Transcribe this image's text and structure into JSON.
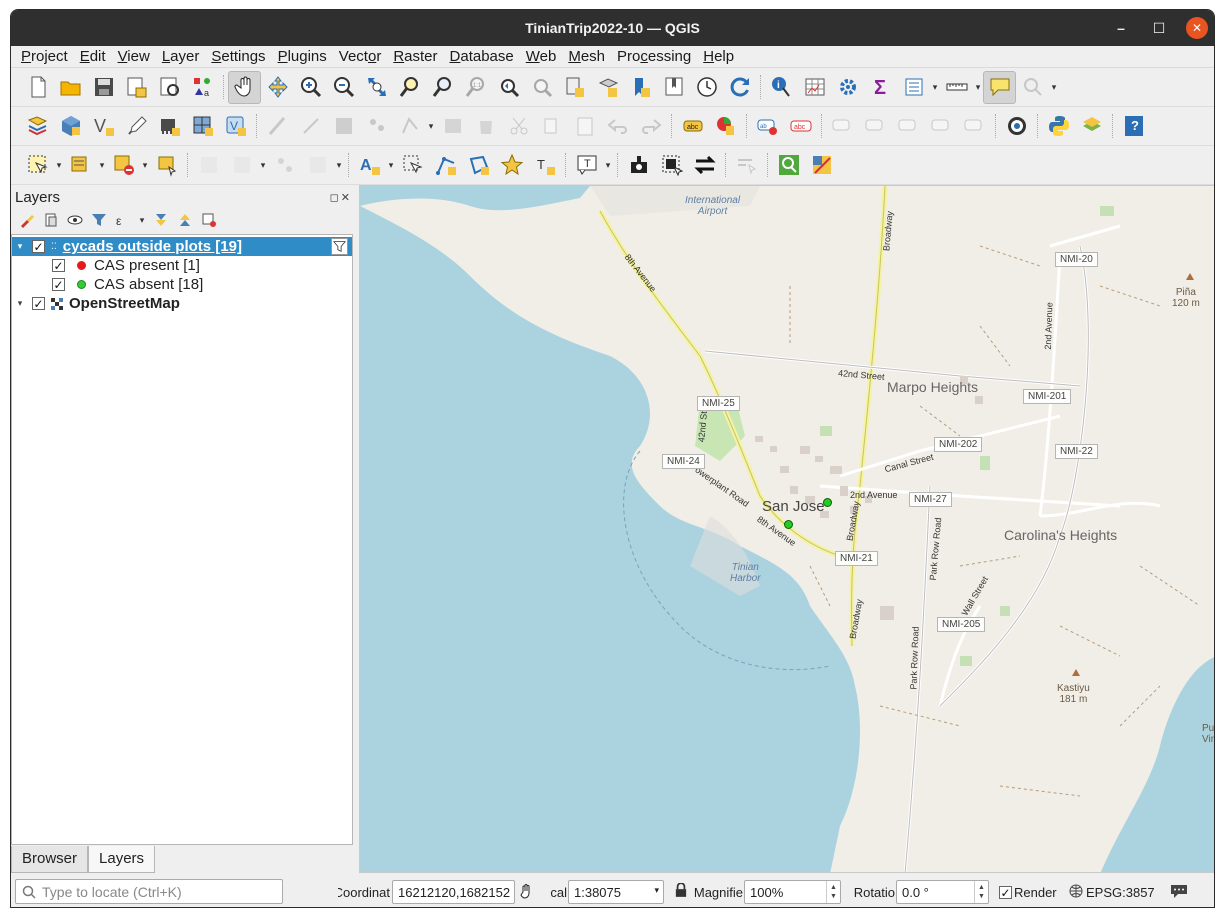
{
  "window": {
    "title": "TinianTrip2022-10 — QGIS",
    "minimize": "–",
    "maximize": "☐",
    "close": "✕"
  },
  "menubar": [
    {
      "label": "Project",
      "u": "P",
      "rest": "roject"
    },
    {
      "label": "Edit",
      "u": "E",
      "rest": "dit"
    },
    {
      "label": "View",
      "u": "V",
      "rest": "iew"
    },
    {
      "label": "Layer",
      "u": "L",
      "rest": "ayer"
    },
    {
      "label": "Settings",
      "u": "S",
      "rest": "ettings"
    },
    {
      "label": "Plugins",
      "u": "P",
      "rest": "lugins"
    },
    {
      "label": "Vector",
      "pre": "Vect",
      "u": "o",
      "rest": "r"
    },
    {
      "label": "Raster",
      "u": "R",
      "rest": "aster"
    },
    {
      "label": "Database",
      "u": "D",
      "rest": "atabase"
    },
    {
      "label": "Web",
      "u": "W",
      "rest": "eb"
    },
    {
      "label": "Mesh",
      "u": "M",
      "rest": "esh"
    },
    {
      "label": "Processing",
      "pre": "Pro",
      "u": "c",
      "rest": "essing"
    },
    {
      "label": "Help",
      "u": "H",
      "rest": "elp"
    }
  ],
  "layers_panel": {
    "title": "Layers",
    "controls": "◻✕",
    "layers": [
      {
        "name": "cycads outside plots [19]",
        "checked": "✓",
        "selected": true,
        "expanded": "▾"
      },
      {
        "name": "CAS present [1]",
        "checked": "✓",
        "color": "#e31a1c"
      },
      {
        "name": "CAS absent [18]",
        "checked": "✓",
        "color": "#33cc33"
      },
      {
        "name": "OpenStreetMap",
        "checked": "✓",
        "expanded": "▾"
      }
    ]
  },
  "bottom_tabs": [
    "Browser",
    "Layers"
  ],
  "map": {
    "town": "San Jose",
    "places": [
      "Marpo Heights",
      "Carolina's Heights"
    ],
    "water_labels": [
      "Tinian\nHarbor"
    ],
    "airport": "International\nAirport",
    "peaks": [
      {
        "name": "Piña",
        "elev": "120 m"
      },
      {
        "name": "Kastiyu",
        "elev": "181 m"
      }
    ],
    "partial_label": "Pu\nVin",
    "roads": [
      "8th Avenue",
      "Broadway",
      "42nd Street",
      "2nd Avenue",
      "Canal Street",
      "Powerplant Road",
      "Park Row Road",
      "Wall Street",
      "42nd Street",
      "2nd Avenue",
      "Broadway",
      "Park Row Road"
    ],
    "shields": [
      "NMI-20",
      "NMI-201",
      "NMI-25",
      "NMI-202",
      "NMI-22",
      "NMI-24",
      "NMI-27",
      "NMI-21",
      "NMI-205"
    ]
  },
  "statusbar": {
    "locate_placeholder": "Type to locate (Ctrl+K)",
    "coordinate_label": "Coordinat",
    "coordinate_value": "16212120,1682152",
    "scale_label": "cal",
    "scale_value": "1:38075",
    "magnifier_label": "Magnifie",
    "magnifier_value": "100%",
    "rotation_label": "Rotatio",
    "rotation_value": "0.0 °",
    "render_label": "Render",
    "render_checked": "✓",
    "crs": "EPSG:3857"
  }
}
